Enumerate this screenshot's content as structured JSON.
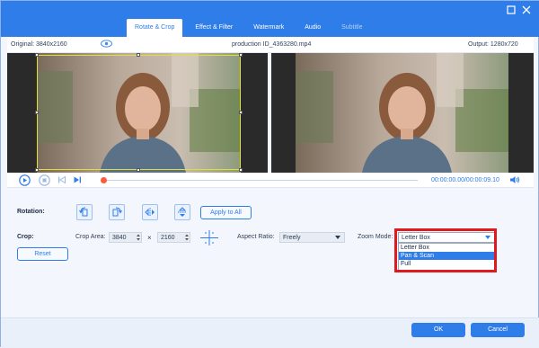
{
  "tabs": [
    {
      "label": "Rotate & Crop"
    },
    {
      "label": "Effect & Filter"
    },
    {
      "label": "Watermark"
    },
    {
      "label": "Audio"
    },
    {
      "label": "Subtitle"
    }
  ],
  "info": {
    "original": "Original: 3840x2160",
    "filename": "production ID_4363280.mp4",
    "output": "Output: 1280x720"
  },
  "player": {
    "time": "00:00:00.00/00:00:09.10"
  },
  "rotation": {
    "label": "Rotation:",
    "apply_all": "Apply to All"
  },
  "crop": {
    "label": "Crop:",
    "area_label": "Crop Area:",
    "width": "3840",
    "times": "×",
    "height": "2160",
    "reset": "Reset"
  },
  "aspect": {
    "label": "Aspect Ratio:",
    "value": "Freely"
  },
  "zoom": {
    "label": "Zoom Mode:",
    "value": "Letter Box",
    "options": [
      "Letter Box",
      "Pan & Scan",
      "Full"
    ]
  },
  "footer": {
    "ok": "OK",
    "cancel": "Cancel"
  },
  "colors": {
    "accent": "#2f7de8",
    "highlight": "#e01a1a",
    "crop_frame": "#e4de2e"
  }
}
